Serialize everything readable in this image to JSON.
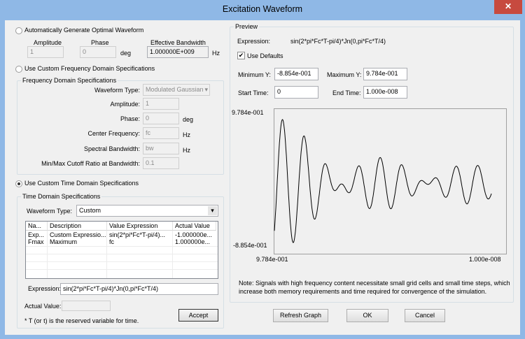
{
  "window": {
    "title": "Excitation Waveform",
    "close_icon": "close-icon"
  },
  "auto": {
    "label": "Automatically Generate Optimal Waveform",
    "selected": false,
    "amplitude_label": "Amplitude",
    "amplitude": "1",
    "phase_label": "Phase",
    "phase": "0",
    "phase_unit": "deg",
    "bandwidth_label": "Effective Bandwidth",
    "bandwidth": "1.000000E+009",
    "bandwidth_unit": "Hz"
  },
  "freq": {
    "label": "Use Custom Frequency Domain Specifications",
    "selected": false,
    "group_title": "Frequency Domain Specifications",
    "waveform_type_label": "Waveform Type:",
    "waveform_type": "Modulated Gaussian",
    "amplitude_label": "Amplitude:",
    "amplitude": "1",
    "phase_label": "Phase:",
    "phase": "0",
    "phase_unit": "deg",
    "center_label": "Center Frequency:",
    "center": "fc",
    "center_unit": "Hz",
    "spectral_label": "Spectral Bandwidth:",
    "spectral": "bw",
    "spectral_unit": "Hz",
    "cutoff_label": "Min/Max Cutoff Ratio at Bandwidth:",
    "cutoff": "0.1"
  },
  "time": {
    "label": "Use Custom Time Domain Specifications",
    "selected": true,
    "group_title": "Time Domain Specifications",
    "waveform_type_label": "Waveform Type:",
    "waveform_type": "Custom",
    "table": {
      "columns": [
        "Na...",
        "Description",
        "Value Expression",
        "Actual Value"
      ],
      "rows": [
        [
          "Exp...",
          "Custom Expressio...",
          "sin(2*pi*Fc*T-pi/4)...",
          "-1.000000e..."
        ],
        [
          "Fmax",
          "Maximum Frequency",
          "fc",
          "1.000000e..."
        ]
      ]
    },
    "expression_label": "Expression:",
    "expression": "sin(2*pi*Fc*T-pi/4)*Jn(0,pi*Fc*T/4)",
    "actual_label": "Actual Value:",
    "actual": "",
    "note": "* T (or t) is the reserved variable for time.",
    "accept": "Accept"
  },
  "preview": {
    "group_title": "Preview",
    "expression_label": "Expression:",
    "expression": "sin(2*pi*Fc*T-pi/4)*Jn(0,pi*Fc*T/4)",
    "use_defaults_label": "Use Defaults",
    "use_defaults": true,
    "min_y_label": "Minimum Y:",
    "min_y": "-8.854e-001",
    "max_y_label": "Maximum Y:",
    "max_y": "9.784e-001",
    "start_label": "Start Time:",
    "start": "0",
    "end_label": "End Time:",
    "end": "1.000e-008",
    "note1": "Note: Signals with high frequency content necessitate small grid cells and small time steps, which",
    "note2": "increase both memory requirements and time required for convergence of the simulation."
  },
  "chart_data": {
    "type": "line",
    "expression": "sin(2*pi*Fc*T-pi/4)*Jn(0,pi*Fc*T/4)",
    "Fc": 1000000000.0,
    "xlim": [
      0,
      1e-08
    ],
    "ylim": [
      -0.8854,
      0.9784
    ],
    "y_tick_labels": [
      "9.784e-001",
      "-8.854e-001"
    ],
    "x_tick_labels": [
      "9.784e-001",
      "1.000e-008"
    ],
    "line_color": "#000000"
  },
  "buttons": {
    "refresh": "Refresh Graph",
    "ok": "OK",
    "cancel": "Cancel"
  }
}
